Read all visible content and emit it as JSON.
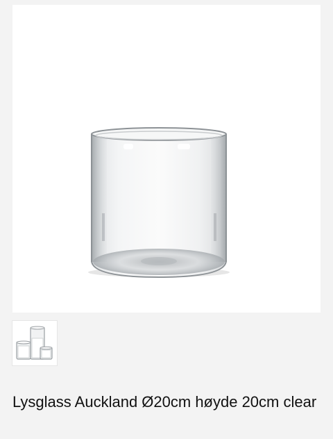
{
  "product": {
    "title": "Lysglass Auckland Ø20cm høyde 20cm clear"
  },
  "gallery": {
    "thumbnail_count": 1,
    "selected_index": 0
  },
  "colors": {
    "page_background": "#f3f3f3",
    "image_background": "#ffffff",
    "title_text": "#111111"
  }
}
